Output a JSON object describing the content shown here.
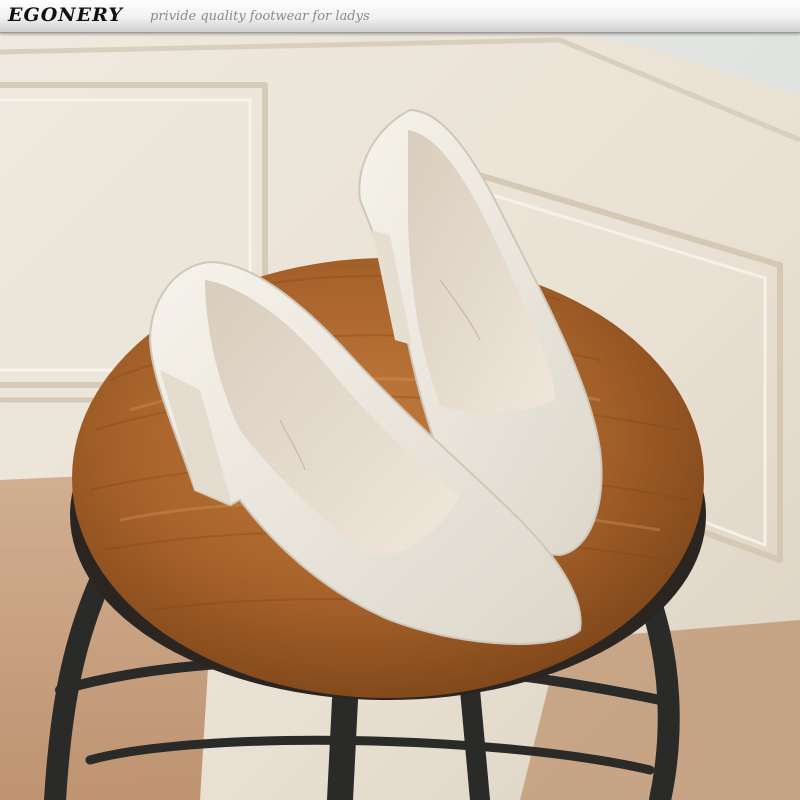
{
  "banner": {
    "brand": "EGONERY",
    "tagline": "privide quality footwear for ladys"
  },
  "photo": {
    "subject": "product-photo"
  },
  "colors": {
    "wall": "#ede6da",
    "wood": "#a9642a",
    "shoe": "#efebe2",
    "metal": "#2a2a28"
  }
}
